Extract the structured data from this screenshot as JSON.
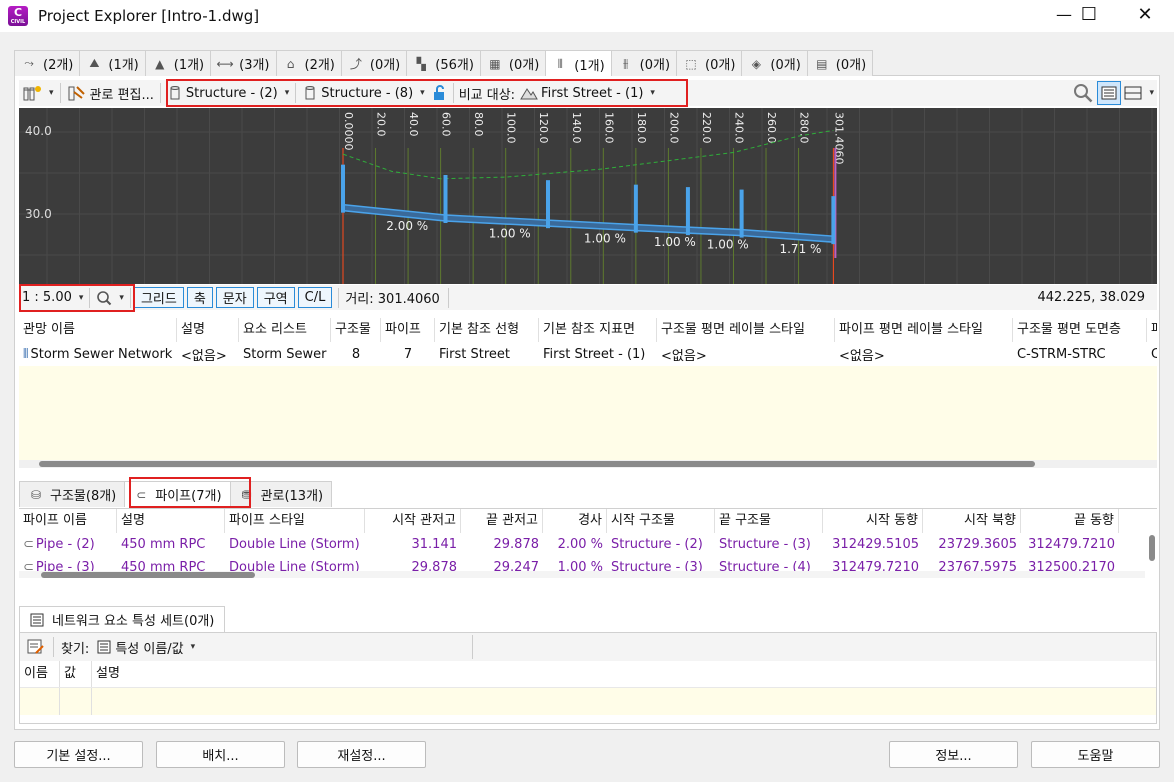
{
  "window": {
    "title": "Project Explorer [Intro-1.dwg]",
    "app_icon_letter": "C",
    "app_icon_sub": "CIVIL"
  },
  "top_tabs": [
    {
      "icon": "alignment-icon",
      "label": "(2개)"
    },
    {
      "icon": "surface-icon",
      "label": "(1개)"
    },
    {
      "icon": "corridor-icon",
      "label": "(1개)"
    },
    {
      "icon": "assembly-icon",
      "label": "(3개)"
    },
    {
      "icon": "parcel-icon",
      "label": "(2개)"
    },
    {
      "icon": "featureline-icon",
      "label": "(0개)"
    },
    {
      "icon": "sample-line-icon",
      "label": "(56개)"
    },
    {
      "icon": "site-icon",
      "label": "(0개)"
    },
    {
      "icon": "pipe-network-icon",
      "label": "(1개)"
    },
    {
      "icon": "pressure-network-icon",
      "label": "(0개)"
    },
    {
      "icon": "viewframe-icon",
      "label": "(0개)"
    },
    {
      "icon": "catchment-icon",
      "label": "(0개)"
    },
    {
      "icon": "data-icon",
      "label": "(0개)"
    }
  ],
  "toolbar": {
    "edit_network": "관로 편집...",
    "start_structure": "Structure - (2)",
    "end_structure": "Structure - (8)",
    "compare_label": "비교 대상:",
    "compare_value": "First Street - (1)"
  },
  "profile": {
    "y_labels": [
      "40.0",
      "30.0"
    ],
    "stations": [
      "0.0000",
      "20.0",
      "40.0",
      "60.0",
      "80.0",
      "100.0",
      "120.0",
      "140.0",
      "160.0",
      "180.0",
      "200.0",
      "220.0",
      "240.0",
      "260.0",
      "280.0",
      "301.4060"
    ],
    "slopes": [
      "2.00 %",
      "1.00 %",
      "1.00 %",
      "1.00 %",
      "1.00 %",
      "1.71 %"
    ]
  },
  "viewbar": {
    "scale": "1 : 5.00",
    "buttons": [
      "그리드",
      "축",
      "문자",
      "구역",
      "C/L"
    ],
    "distance": "거리: 301.4060",
    "coords": "442.225, 38.029"
  },
  "network_table": {
    "headers": [
      "관망 이름",
      "설명",
      "요소 리스트",
      "구조물",
      "파이프",
      "기본 참조 선형",
      "기본 참조 지표면",
      "구조물 평면 레이블 스타일",
      "파이프 평면 레이블 스타일",
      "구조물 평면 도면층",
      "파"
    ],
    "row": [
      "Storm Sewer Network",
      "<없음>",
      "Storm Sewer",
      "8",
      "7",
      "First Street",
      "First Street - (1)",
      "<없음>",
      "<없음>",
      "C-STRM-STRC",
      "C"
    ]
  },
  "sub_tabs": [
    {
      "icon": "structure-icon",
      "label": "구조물(8개)"
    },
    {
      "icon": "pipe-icon",
      "label": "파이프(7개)"
    },
    {
      "icon": "network-icon",
      "label": "관로(13개)"
    }
  ],
  "pipe_table": {
    "headers": [
      "파이프 이름",
      "설명",
      "파이프 스타일",
      "시작 관저고",
      "끝 관저고",
      "경사",
      "시작 구조물",
      "끝 구조물",
      "시작 동향",
      "시작 북향",
      "끝 동향"
    ],
    "rows": [
      [
        "Pipe - (2)",
        "450 mm RPC",
        "Double Line (Storm)",
        "31.141",
        "29.878",
        "2.00 %",
        "Structure - (2)",
        "Structure - (3)",
        "312429.5105",
        "23729.3605",
        "312479.7210"
      ],
      [
        "Pipe - (3)",
        "450 mm RPC",
        "Double Line (Storm)",
        "29.878",
        "29.247",
        "1.00 %",
        "Structure - (3)",
        "Structure - (4)",
        "312479.7210",
        "23767.5975",
        "312500.2170"
      ]
    ]
  },
  "property_sets": {
    "tab_label": "네트워크 요소 특성 세트(0개)",
    "find_label": "찾기:",
    "find_value": "특성 이름/값",
    "headers": [
      "이름",
      "값",
      "설명"
    ]
  },
  "buttons": {
    "settings": "기본 설정...",
    "layout": "배치...",
    "reset": "재설정...",
    "about": "정보...",
    "help": "도움말"
  },
  "colors": {
    "accent": "#2a8bd8",
    "purple_text": "#7a1fa8",
    "highlight_box": "#e02020",
    "profile_bg": "#3c3c3c",
    "pipe": "#4aa3ea"
  }
}
